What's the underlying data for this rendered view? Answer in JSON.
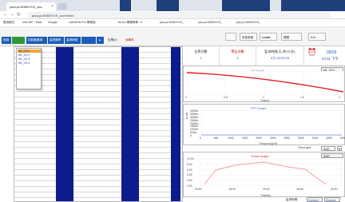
{
  "browser": {
    "tab_title": "paul-pc:8080/VVS_acc",
    "url": "paul-pc:8080/VVS_acc/Home",
    "bookmarks": [
      "應用程式",
      "Intel IEP - Main",
      "Google",
      "LabVIEW Pro 專業版",
      "lbLion 專業教學 - E",
      "pau-pc:8080/VVS_",
      "pau-pc:8080/VVS_",
      "pau-pc:8080/VVS_"
    ]
  },
  "toolbar": {
    "left_buttons": [
      "首頁",
      "",
      "控制器選項",
      "量測頻率",
      "量測參數",
      ""
    ],
    "warn_label": "告警(0)",
    "alarm_label": "@事件",
    "right_buttons": [
      "",
      "系統參數",
      "e-mail",
      "關閉",
      "Exit"
    ]
  },
  "status": {
    "card1": {
      "label": "告警次數",
      "value": "0"
    },
    "card2": {
      "label": "警告次數",
      "value": "0"
    },
    "card3": {
      "label": "監測時間(天-時:分:秒)",
      "value": "0天-00:00:05"
    },
    "date": "09/26",
    "time": "04:31 下午"
  },
  "channels": [
    "M1_CH 1",
    "M1_CH 2",
    "M1_CH 3",
    "M1_CH 4"
  ],
  "charts": {
    "yt": {
      "title": "YT Graph",
      "legend": "M1_CH 1",
      "xlabel": "Time(s)",
      "xticks": [
        "0",
        "0.5",
        "1",
        "1.5",
        "2"
      ]
    },
    "fft": {
      "title": "FFT Graph",
      "ylabel": "g rms",
      "xlabel": "Frequency(Hz)",
      "yticks": [
        "4000m",
        "3500m",
        "3000m",
        "2500m",
        "2000m",
        "1500m",
        "1000m",
        "500m",
        "0"
      ],
      "xticks": [
        "0",
        "500",
        "1000",
        "1500",
        "2000",
        "2500",
        "3000",
        "3500",
        "4000",
        "4500",
        "5000"
      ]
    },
    "trend_control": {
      "label": "Trend type",
      "value": "RMS"
    },
    "trend": {
      "title": "Trend Graph",
      "legend": "RMS",
      "xlabel": "Time(hh)",
      "yticks": [
        "10.00",
        "8.00",
        "6.00",
        "4.00",
        "2.00",
        "0.00"
      ],
      "xticks": [
        "00:00",
        "06:00",
        "00:00",
        "06:00",
        "00:00"
      ]
    }
  },
  "footer": {
    "caption": "量測時間",
    "button1": "Connect",
    "button2": "Disconn"
  }
}
